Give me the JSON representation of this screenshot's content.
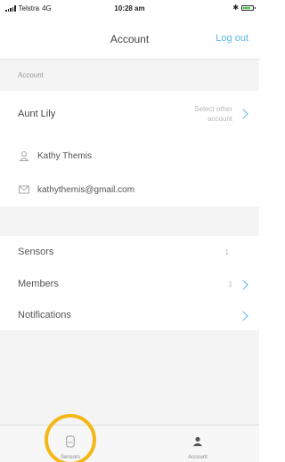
{
  "status_bar": {
    "carrier": "Telstra",
    "network": "4G",
    "time": "10:28 am"
  },
  "nav": {
    "title": "Account",
    "logout_label": "Log out"
  },
  "section": {
    "header": "Account"
  },
  "account": {
    "name": "Aunt Lily",
    "select_other_line1": "Select other",
    "select_other_line2": "account",
    "user_name": "Kathy Themis",
    "email": "kathythemis@gmail.com"
  },
  "list": {
    "items": [
      {
        "label": "Sensors",
        "count": "1",
        "chevron": false
      },
      {
        "label": "Members",
        "count": "1",
        "chevron": true
      },
      {
        "label": "Notifications",
        "count": "",
        "chevron": true
      }
    ]
  },
  "tabs": [
    {
      "label": "Sensors",
      "icon": "sensor-icon",
      "highlighted": true
    },
    {
      "label": "Account",
      "icon": "person-icon",
      "highlighted": false
    }
  ],
  "colors": {
    "accent": "#5cb6e6",
    "highlight": "#f3b718",
    "background": "#f4f4f4"
  }
}
